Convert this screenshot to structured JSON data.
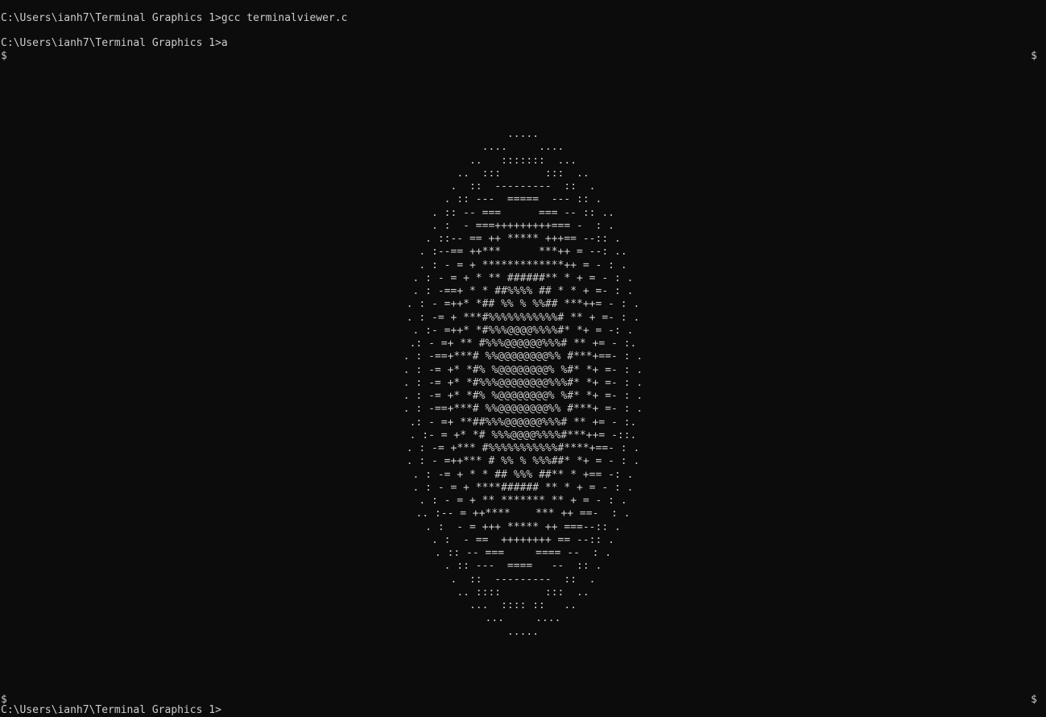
{
  "console": {
    "command1": "C:\\Users\\ianh7\\Terminal Graphics 1>gcc terminalviewer.c",
    "command2": "C:\\Users\\ianh7\\Terminal Graphics 1>a",
    "marker": "$",
    "partial_prompt": "C:\\Users\\ianh7\\Terminal Graphics 1>"
  },
  "ascii_art": [
    ".....",
    "....     ....",
    "..   :::::::  ...",
    "..  :::       :::  ..",
    ".  ::  ---------  ::  .",
    ". :: ---  =====  --- :: .",
    ". :: -- ===      === -- :: ..",
    ". :  - ===+++++++++=== -  : .",
    ". ::-- == ++ ***** +++== --:: .",
    ". :--== ++***      ***++ = --: ..",
    ". : - = + *************++ = - : .",
    ". : - = + * ** ######** * + = - : .",
    ". : -==+ * * ##%%%% ## * * + =- : .",
    ". : - =++* *## %% % %%## ***++= - : .",
    ". : -= + ***#%%%%%%%%%%%# ** + =- : .",
    ". :- =++* *#%%%@@@@%%%%#* *+ = -: .",
    ".: - =+ ** #%%%@@@@@@%%%# ** += - :.",
    ". : -==+***# %%@@@@@@@@%% #***+==- : .",
    ". : -= +* *#% %@@@@@@@@% %#* *+ =- : .",
    ". : -= +* *#%%%@@@@@@@@%%%#* *+ =- : .",
    ". : -= +* *#% %@@@@@@@@% %#* *+ =- : .",
    ". : -==+***# %%@@@@@@@@%% #***+ =- : .",
    ".: - =+ **##%%%@@@@@@%%%# ** += - :.",
    ". :- = +* *# %%%@@@@%%%%#***++= -::.",
    ". : -= +*** #%%%%%%%%%%%#****+==- : .",
    ". : - =++*** # %% % %%%##* *+ = - : .",
    ". : -= + * * ## %%% ##** * +== -: .",
    ". : - = + ****###### ** * + = - : .",
    ". : - = + ** ******* ** + = - : .",
    ".. :-- = ++****    *** ++ ==-  : .",
    ". :  - = +++ ***** ++ ===--:: .",
    ". :  - ==  ++++++++ == --:: .",
    ". :: -- ===     ==== --  : .",
    ". :: ---  ====   --  :: .",
    ".  ::  ---------  ::  .",
    ".. ::::       :::  ..",
    "...  :::: ::   ..",
    "...     ....",
    "....."
  ]
}
